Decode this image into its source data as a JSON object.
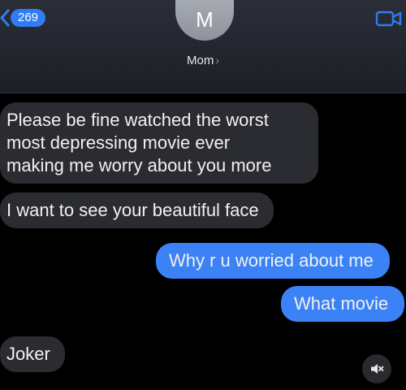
{
  "header": {
    "unread_count": "269",
    "avatar_initial": "M",
    "contact_name": "Mom",
    "contact_chevron": "›"
  },
  "messages": [
    {
      "direction": "incoming",
      "text": "Please be fine watched the worst\nmost depressing movie ever\nmaking me worry about you more"
    },
    {
      "direction": "incoming",
      "text": "I want to see your beautiful face"
    },
    {
      "direction": "outgoing",
      "text": "Why r u worried about me"
    },
    {
      "direction": "outgoing",
      "text": "What movie"
    },
    {
      "direction": "incoming",
      "text": "Joker"
    }
  ],
  "icons": {
    "back": "chevron-left-icon",
    "video": "video-camera-icon",
    "sound": "speaker-muted-icon"
  },
  "colors": {
    "background": "#000000",
    "header": "#23262e",
    "incoming_bubble": "#2b2c32",
    "outgoing_bubble": "#3b82f6",
    "accent": "#2f7cf6"
  }
}
